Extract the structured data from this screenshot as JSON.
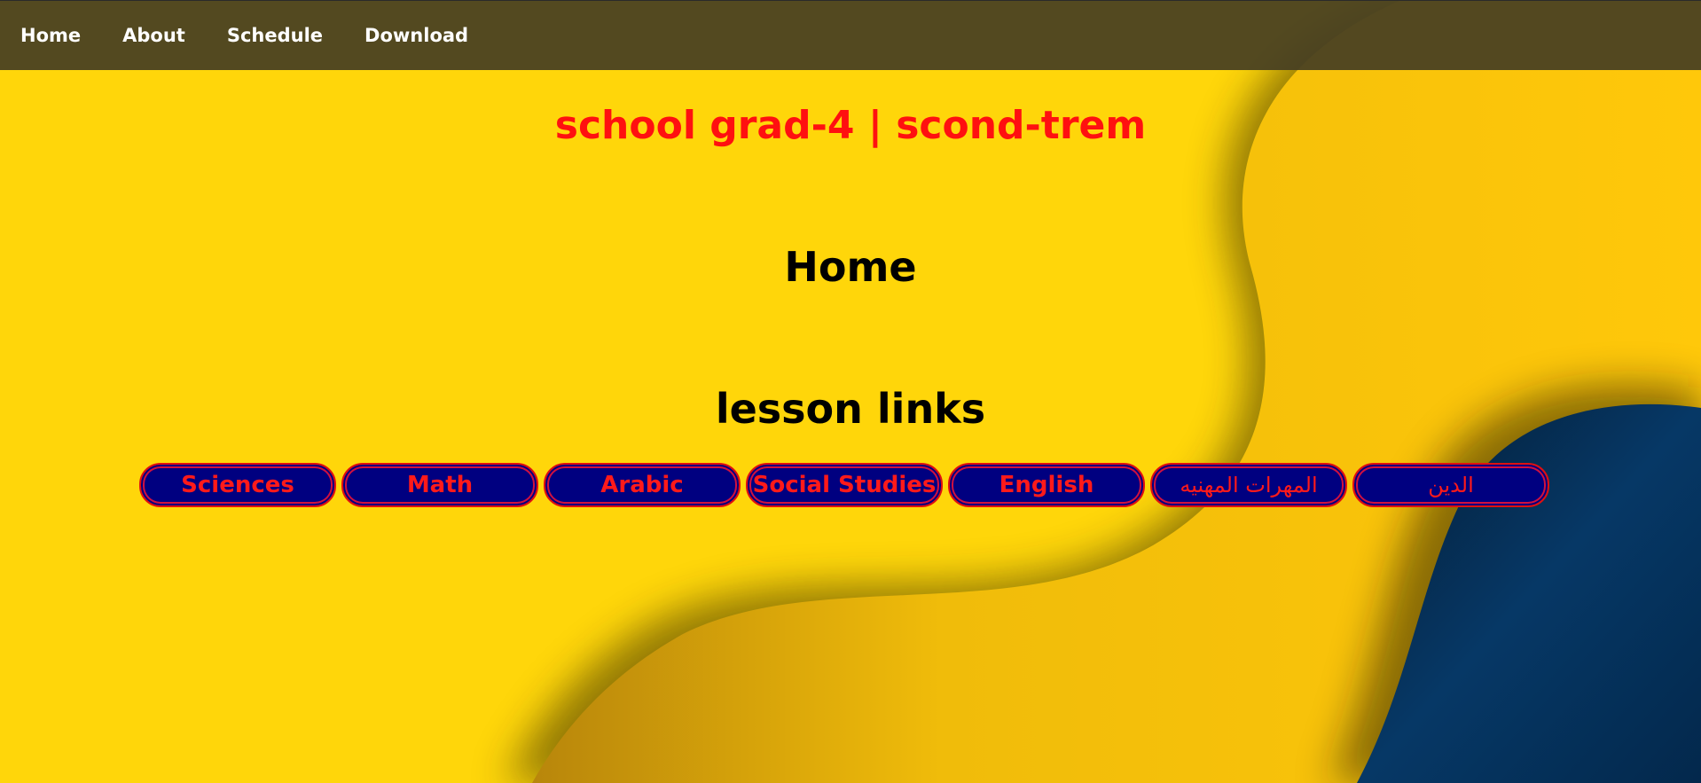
{
  "nav": {
    "items": [
      {
        "label": "Home"
      },
      {
        "label": "About"
      },
      {
        "label": "Schedule"
      },
      {
        "label": "Download"
      }
    ]
  },
  "header": {
    "title": "school grad-4 | scond-trem"
  },
  "main": {
    "home_heading": "Home",
    "lessons_heading": "lesson links",
    "lessons": [
      {
        "label": "Sciences"
      },
      {
        "label": "Math"
      },
      {
        "label": "Arabic"
      },
      {
        "label": "Social Studies"
      },
      {
        "label": "English"
      },
      {
        "label": "المهرات المهنيه"
      },
      {
        "label": "الدين"
      }
    ]
  },
  "colors": {
    "background_yellow": "#ffd60a",
    "nav_bar": "#463e22",
    "title_red": "#ff1010",
    "button_fill": "#000080",
    "button_border": "#e01010",
    "wave_blue": "#04305a"
  }
}
